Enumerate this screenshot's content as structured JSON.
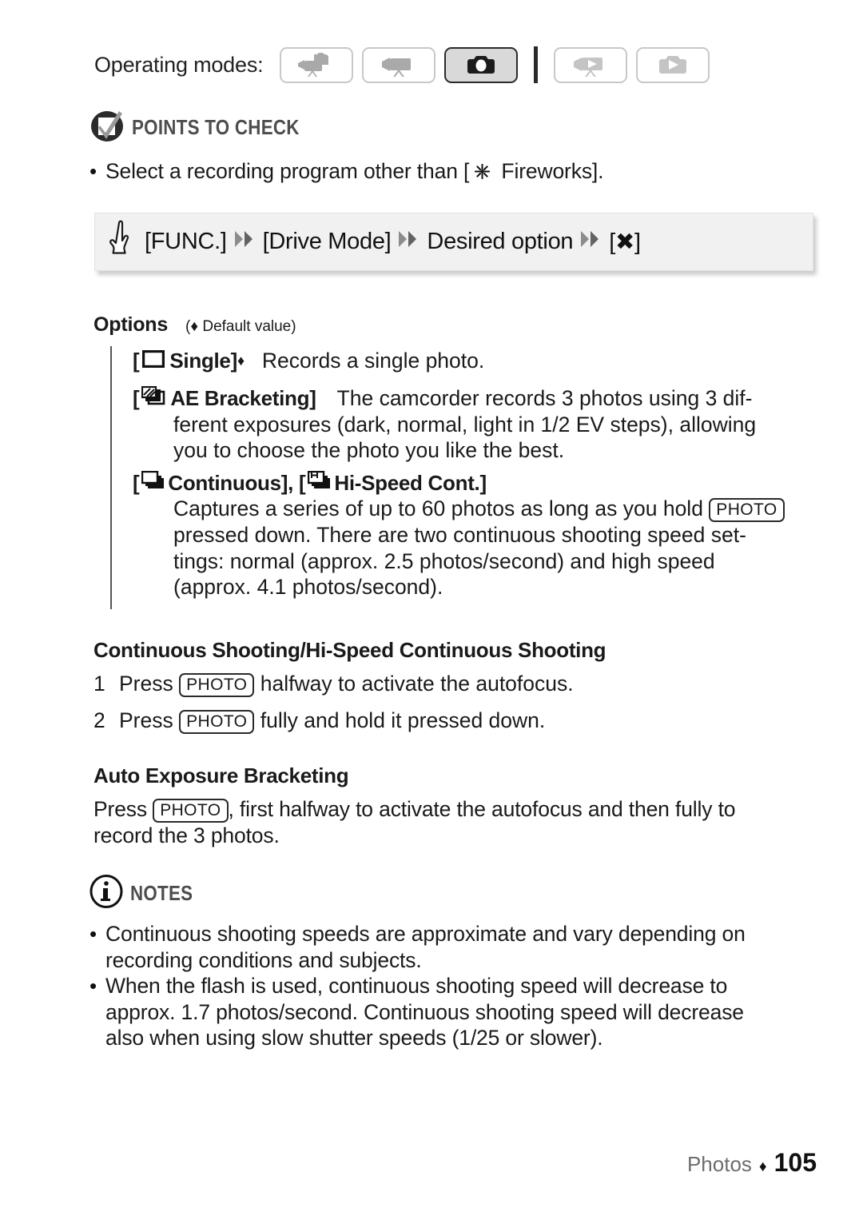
{
  "operating_modes": {
    "label": "Operating modes:",
    "chips": [
      {
        "name": "dual-record-mode-icon",
        "active": false,
        "type": "dual"
      },
      {
        "name": "movie-record-mode-icon",
        "active": false,
        "type": "movie"
      },
      {
        "name": "photo-record-mode-icon",
        "active": true,
        "type": "photo"
      },
      {
        "name": "movie-playback-mode-icon",
        "active": false,
        "type": "movie-play"
      },
      {
        "name": "photo-playback-mode-icon",
        "active": false,
        "type": "photo-play"
      }
    ]
  },
  "points_to_check": {
    "title": "POINTS TO CHECK",
    "bullets": [
      {
        "before": "Select a recording program other than [",
        "icon": "fireworks-icon",
        "after": " Fireworks]."
      }
    ]
  },
  "func_bar": {
    "hand_icon": "pointing-hand-icon",
    "steps": [
      "[FUNC.]",
      "[Drive Mode]",
      "Desired option",
      "[✖]"
    ],
    "separator_icon": "double-chevron-right-icon"
  },
  "options": {
    "heading": "Options",
    "default_note": "(♦ Default value)",
    "items": [
      {
        "icon": "single-frame-icon",
        "label": "Single",
        "bracket_open": "[",
        "bracket_close": "]",
        "default_marker": "♦",
        "description": "Records a single photo."
      },
      {
        "icon": "ae-bracketing-icon",
        "label": "AE Bracketing",
        "bracket_open": "[",
        "bracket_close": "]",
        "description_lines": [
          "The camcorder records 3 photos using 3 dif-",
          "ferent exposures (dark, normal, light in 1/2 EV steps), allowing",
          "you to choose the photo you like the best."
        ]
      },
      {
        "title_parts": {
          "p1": "[",
          "icon1": "continuous-icon",
          "p2": " Continuous], [",
          "icon2": "hi-speed-continuous-icon",
          "p3": " Hi-Speed Cont.]"
        },
        "description_lines": [
          {
            "text": "Captures a series of up to 60 photos as long as you hold ",
            "key": "PHOTO",
            "tail": ""
          },
          {
            "text": "pressed down. There are two continuous shooting speed set-"
          },
          {
            "text": "tings: normal (approx. 2.5 photos/second) and high speed"
          },
          {
            "text": "(approx. 4.1 photos/second)."
          }
        ]
      }
    ]
  },
  "continuous_section": {
    "heading": "Continuous Shooting/Hi-Speed Continuous Shooting",
    "steps": [
      {
        "num": "1",
        "before": "Press ",
        "key": "PHOTO",
        "after": " halfway to activate the autofocus."
      },
      {
        "num": "2",
        "before": "Press ",
        "key": "PHOTO",
        "after": " fully and hold it pressed down."
      }
    ]
  },
  "aeb_section": {
    "heading": "Auto Exposure Bracketing",
    "paragraph": {
      "before": "Press ",
      "key": "PHOTO",
      "after": ", first halfway to activate the autofocus and then fully to",
      "line2": "record the 3 photos."
    }
  },
  "notes": {
    "title": "NOTES",
    "icon": "info-circle-icon",
    "bullets": [
      [
        "Continuous shooting speeds are approximate and vary depending on",
        "recording conditions and subjects."
      ],
      [
        "When the flash is used, continuous shooting speed will decrease to",
        "approx. 1.7 photos/second. Continuous shooting speed will decrease",
        "also when using slow shutter speeds (1/25 or slower)."
      ]
    ]
  },
  "footer": {
    "label": "Photos",
    "diamond": "♦",
    "page": "105"
  }
}
